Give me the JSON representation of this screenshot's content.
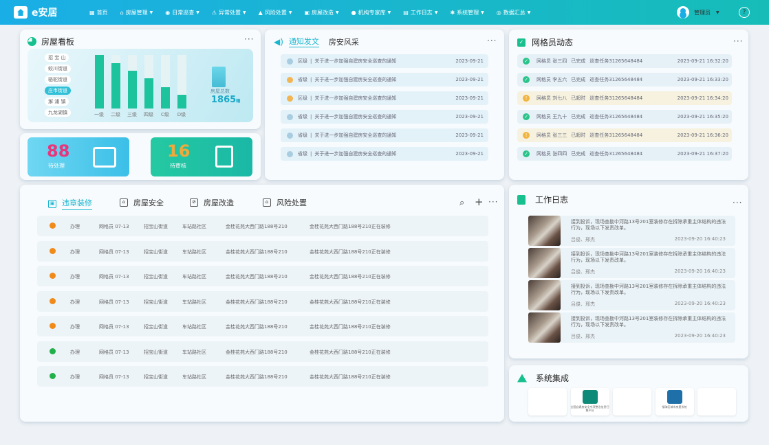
{
  "app": {
    "title": "e安居"
  },
  "nav": [
    {
      "label": "首页",
      "icon": "grid-icon",
      "caret": false
    },
    {
      "label": "房屋管理",
      "icon": "house-icon",
      "caret": true
    },
    {
      "label": "日常巡查",
      "icon": "patrol-icon",
      "caret": true
    },
    {
      "label": "异常处置",
      "icon": "alert-icon",
      "caret": true
    },
    {
      "label": "风险处置",
      "icon": "warning-icon",
      "caret": true
    },
    {
      "label": "房屋改造",
      "icon": "renovate-icon",
      "caret": true
    },
    {
      "label": "机构专家库",
      "icon": "expert-icon",
      "caret": true
    },
    {
      "label": "工作日志",
      "icon": "log-icon",
      "caret": true
    },
    {
      "label": "系统管理",
      "icon": "gear-icon",
      "caret": true
    },
    {
      "label": "数据汇总",
      "icon": "data-icon",
      "caret": true
    }
  ],
  "user": {
    "name": "管理员"
  },
  "house_board": {
    "title": "房屋看板",
    "streets": [
      "招 宝 山",
      "蛟川街道",
      "骆驼街道",
      "庄市街道",
      "澥 浦 镇",
      "九龙湖镇"
    ],
    "active_street_index": 3,
    "total_label": "房屋总数",
    "total_value": "1865",
    "total_unit": "幢",
    "bars": [
      {
        "label": "一级",
        "value": 1.0
      },
      {
        "label": "二级",
        "value": 0.85
      },
      {
        "label": "三级",
        "value": 0.71
      },
      {
        "label": "四级",
        "value": 0.56
      },
      {
        "label": "C级",
        "value": 0.4
      },
      {
        "label": "D级",
        "value": 0.26
      }
    ]
  },
  "stats": {
    "pending": {
      "value": "88",
      "label": "待处理"
    },
    "review": {
      "value": "16",
      "label": "待审核"
    }
  },
  "notices": {
    "tab_active": "通知发文",
    "tab_other": "房安风采",
    "items": [
      {
        "level": "区级",
        "text": "关于进一步加强自建房安全巡查的通知",
        "date": "2023-09-21",
        "color": "#a8cde0"
      },
      {
        "level": "省级",
        "text": "关于进一步加强自建房安全巡查的通知",
        "date": "2023-09-21",
        "color": "#f2b552"
      },
      {
        "level": "区级",
        "text": "关于进一步加强自建房安全巡查的通知",
        "date": "2023-09-21",
        "color": "#f2b552"
      },
      {
        "level": "省级",
        "text": "关于进一步加强自建房安全巡查的通知",
        "date": "2023-09-21",
        "color": "#a8cde0"
      },
      {
        "level": "省级",
        "text": "关于进一步加强自建房安全巡查的通知",
        "date": "2023-09-21",
        "color": "#a8cde0"
      },
      {
        "level": "省级",
        "text": "关于进一步加强自建房安全巡查的通知",
        "date": "2023-09-21",
        "color": "#a8cde0"
      }
    ]
  },
  "grid_dynamics": {
    "title": "网格员动态",
    "items": [
      {
        "who": "网格员 张三四",
        "status": "已完成",
        "task": "巡查任务31265648484",
        "time": "2023-09-21 16:32:20",
        "type": "done"
      },
      {
        "who": "网格员 李五六",
        "status": "已完成",
        "task": "巡查任务31265648484",
        "time": "2023-09-21 16:33:20",
        "type": "done"
      },
      {
        "who": "网格员 刘七八",
        "status": "已超时",
        "task": "巡查任务31265648484",
        "time": "2023-09-21 16:34:20",
        "type": "late"
      },
      {
        "who": "网格员 王九十",
        "status": "已完成",
        "task": "巡查任务31265648484",
        "time": "2023-09-21 16:35:20",
        "type": "done"
      },
      {
        "who": "网格员 张三三",
        "status": "已超时",
        "task": "巡查任务31265648484",
        "time": "2023-09-21 16:36:20",
        "type": "late"
      },
      {
        "who": "网格员 张四四",
        "status": "已完成",
        "task": "巡查任务31265648484",
        "time": "2023-09-21 16:37:20",
        "type": "done"
      }
    ]
  },
  "violations": {
    "tabs": [
      "违章装修",
      "房屋安全",
      "房屋改造",
      "风险处置"
    ],
    "rows": [
      {
        "action": "办理",
        "who": "网格员 07-13",
        "street": "招宝山街道",
        "community": "车站路社区",
        "addr": "金桂花苑大西门路188号210",
        "desc": "金桂花苑大西门路188号210正在装修",
        "dot": "#f08a1a"
      },
      {
        "action": "办理",
        "who": "网格员 07-13",
        "street": "招宝山街道",
        "community": "车站路社区",
        "addr": "金桂花苑大西门路188号210",
        "desc": "金桂花苑大西门路188号210正在装修",
        "dot": "#f08a1a"
      },
      {
        "action": "办理",
        "who": "网格员 07-13",
        "street": "招宝山街道",
        "community": "车站路社区",
        "addr": "金桂花苑大西门路188号210",
        "desc": "金桂花苑大西门路188号210正在装修",
        "dot": "#f08a1a"
      },
      {
        "action": "办理",
        "who": "网格员 07-13",
        "street": "招宝山街道",
        "community": "车站路社区",
        "addr": "金桂花苑大西门路188号210",
        "desc": "金桂花苑大西门路188号210正在装修",
        "dot": "#f08a1a"
      },
      {
        "action": "办理",
        "who": "网格员 07-13",
        "street": "招宝山街道",
        "community": "车站路社区",
        "addr": "金桂花苑大西门路188号210",
        "desc": "金桂花苑大西门路188号210正在装修",
        "dot": "#f08a1a"
      },
      {
        "action": "办理",
        "who": "网格员 07-13",
        "street": "招宝山街道",
        "community": "车站路社区",
        "addr": "金桂花苑大西门路188号210",
        "desc": "金桂花苑大西门路188号210正在装修",
        "dot": "#22b04a"
      },
      {
        "action": "办理",
        "who": "网格员 07-13",
        "street": "招宝山街道",
        "community": "车站路社区",
        "addr": "金桂花苑大西门路188号210",
        "desc": "金桂花苑大西门路188号210正在装修",
        "dot": "#22b04a"
      }
    ]
  },
  "work_log": {
    "title": "工作日志",
    "items": [
      {
        "text": "接到投诉，现场查勘中河路13号201室装修存在拆除承重主体结构的违法行为，现场以下发责改单。",
        "names": "吕俊、邢杰",
        "time": "2023-09-20 16:40:23"
      },
      {
        "text": "接到投诉，现场查勘中河路13号201室装修存在拆除承重主体结构的违法行为，现场以下发责改单。",
        "names": "吕俊、邢杰",
        "time": "2023-09-20 16:40:23"
      },
      {
        "text": "接到投诉，现场查勘中河路13号201室装修存在拆除承重主体结构的违法行为，现场以下发责改单。",
        "names": "吕俊、邢杰",
        "time": "2023-09-20 16:40:23"
      },
      {
        "text": "接到投诉，现场查勘中河路13号201室装修存在拆除承重主体结构的违法行为，现场以下发责改单。",
        "names": "吕俊、邢杰",
        "time": "2023-09-20 16:40:23"
      }
    ]
  },
  "system_integration": {
    "title": "系统集成",
    "cards": [
      {
        "label": ""
      },
      {
        "label": "全国自建房安全专项整治信息归集平台"
      },
      {
        "label": ""
      },
      {
        "label": "镇海区城市房屋系统"
      },
      {
        "label": ""
      }
    ]
  },
  "colors": {
    "accent": "#19b6cf",
    "green": "#1cc39d",
    "pink": "#e8367c",
    "orange": "#f2a93b"
  }
}
